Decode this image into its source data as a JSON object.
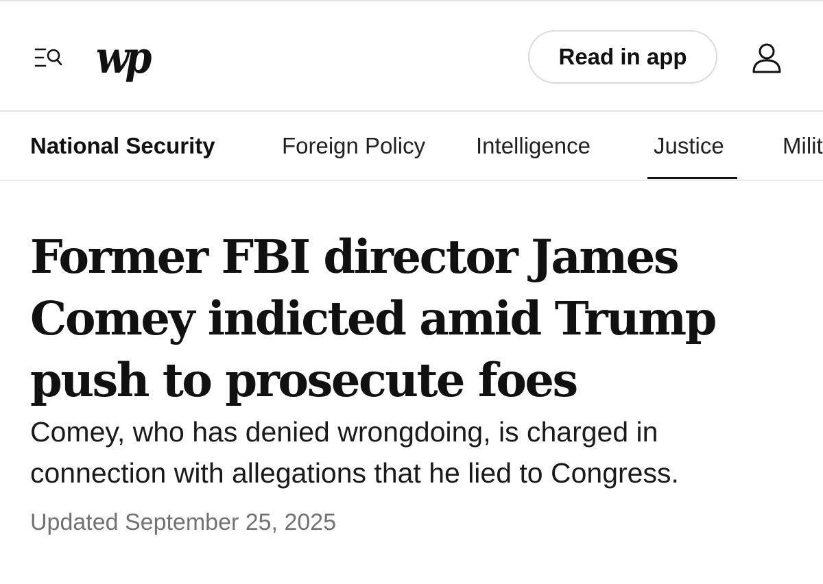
{
  "header": {
    "logo_text": "wp",
    "read_in_app_label": "Read in app"
  },
  "subnav": {
    "section_label": "National Security",
    "items": [
      "Foreign Policy",
      "Intelligence",
      "Justice",
      "Milit"
    ],
    "active_item": "Justice"
  },
  "article": {
    "headline": "Former FBI director James Comey indicted amid Trump push to prosecute foes",
    "dek": "Comey, who has denied wrongdoing, is charged in connection with allegations that he lied to Congress.",
    "timestamp": "Updated September 25, 2025"
  },
  "icons": {
    "menu": "menu-search-icon",
    "account": "user-icon"
  }
}
